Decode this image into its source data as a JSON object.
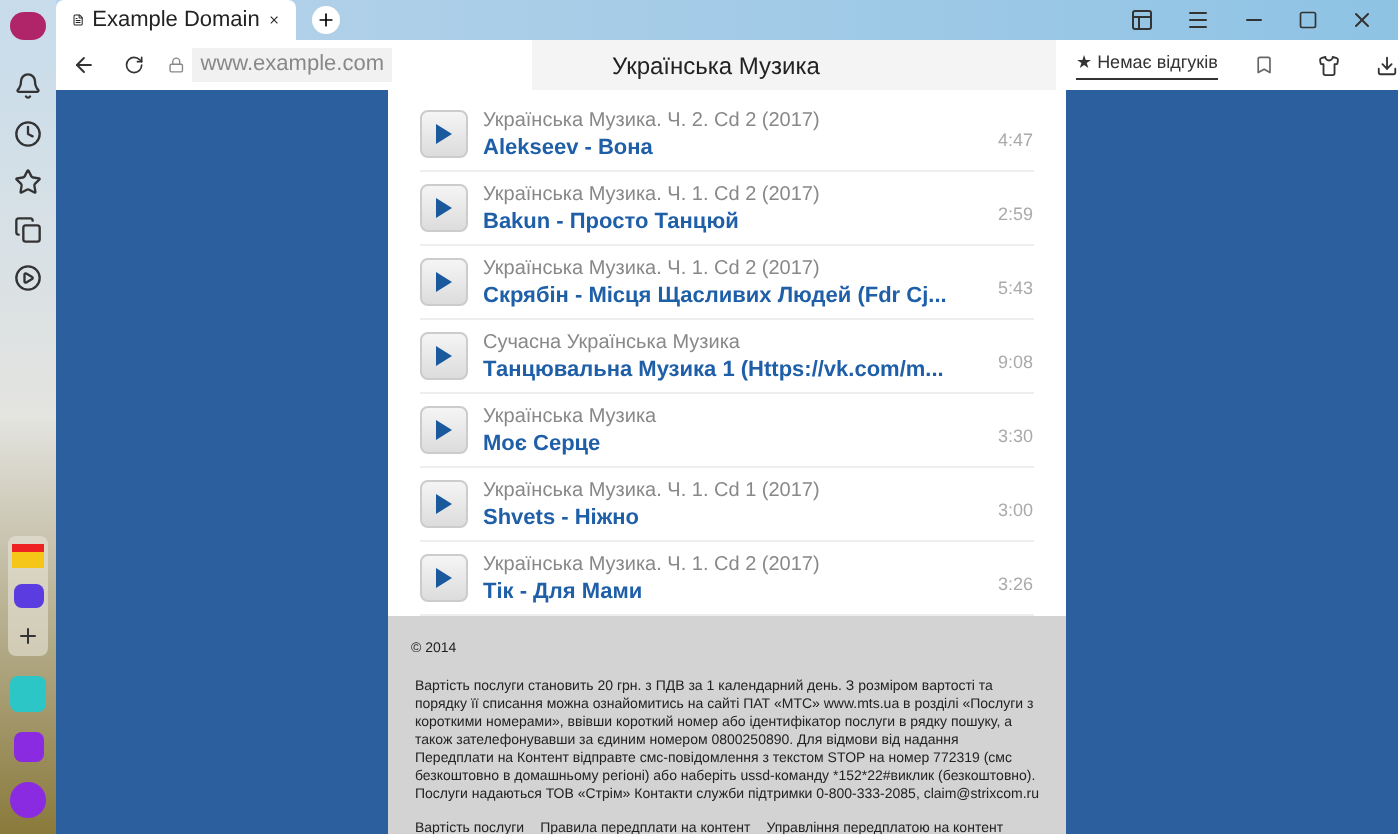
{
  "tab": {
    "title": "Example Domain",
    "selected": true
  },
  "address": {
    "url": "www.example.com",
    "page_title": "Українська Музика",
    "reviews_icon": "★",
    "reviews": "Немає відгуків"
  },
  "tracks": [
    {
      "album": "Українська Музика. Ч. 2. Cd 2 (2017)",
      "title": "Alekseev - Вона",
      "duration": "4:47"
    },
    {
      "album": "Українська Музика. Ч. 1. Cd 2 (2017)",
      "title": "Bakun - Просто Танцюй",
      "duration": "2:59"
    },
    {
      "album": "Українська Музика. Ч. 1. Cd 2 (2017)",
      "title": "Скрябін - Місця Щасливих Людей (Fdr Cj...",
      "duration": "5:43"
    },
    {
      "album": "Сучасна Українська Музика",
      "title": "Танцювальна Музика 1 (Https://vk.com/m...",
      "duration": "9:08"
    },
    {
      "album": "Українська Музика",
      "title": "Моє Серце",
      "duration": "3:30"
    },
    {
      "album": "Українська Музика. Ч. 1. Cd 1 (2017)",
      "title": "Shvets - Ніжно",
      "duration": "3:00"
    },
    {
      "album": "Українська Музика. Ч. 1. Cd 2 (2017)",
      "title": "Тік - Для Мами",
      "duration": "3:26"
    }
  ],
  "footer": {
    "copyright": "© 2014",
    "text": "Вартість послуги становить 20 грн. з ПДВ за 1 календарний день. З розміром вартості та порядку її списання можна ознайомитись на сайті ПАТ «МТС» www.mts.ua в розділі «Послуги з короткими номерами», ввівши короткий номер або ідентифікатор послуги в рядку пошуку, а також зателефонувавши за єдиним номером 0800250890. Для відмови від надання Передплати на Контент відправте смс-повідомлення з текстом STOP на номер 772319 (смс безкоштовно в домашньому регіоні) або наберіть ussd-команду *152*22#виклик (безкоштовно). Послуги надаються ТОВ «Стрім» Контакти служби підтримки 0-800-333-2085, claim@strixcom.ru",
    "links": [
      "Вартість послуги",
      "Правила передплати на контент",
      "Управління передплатою на контент"
    ]
  }
}
